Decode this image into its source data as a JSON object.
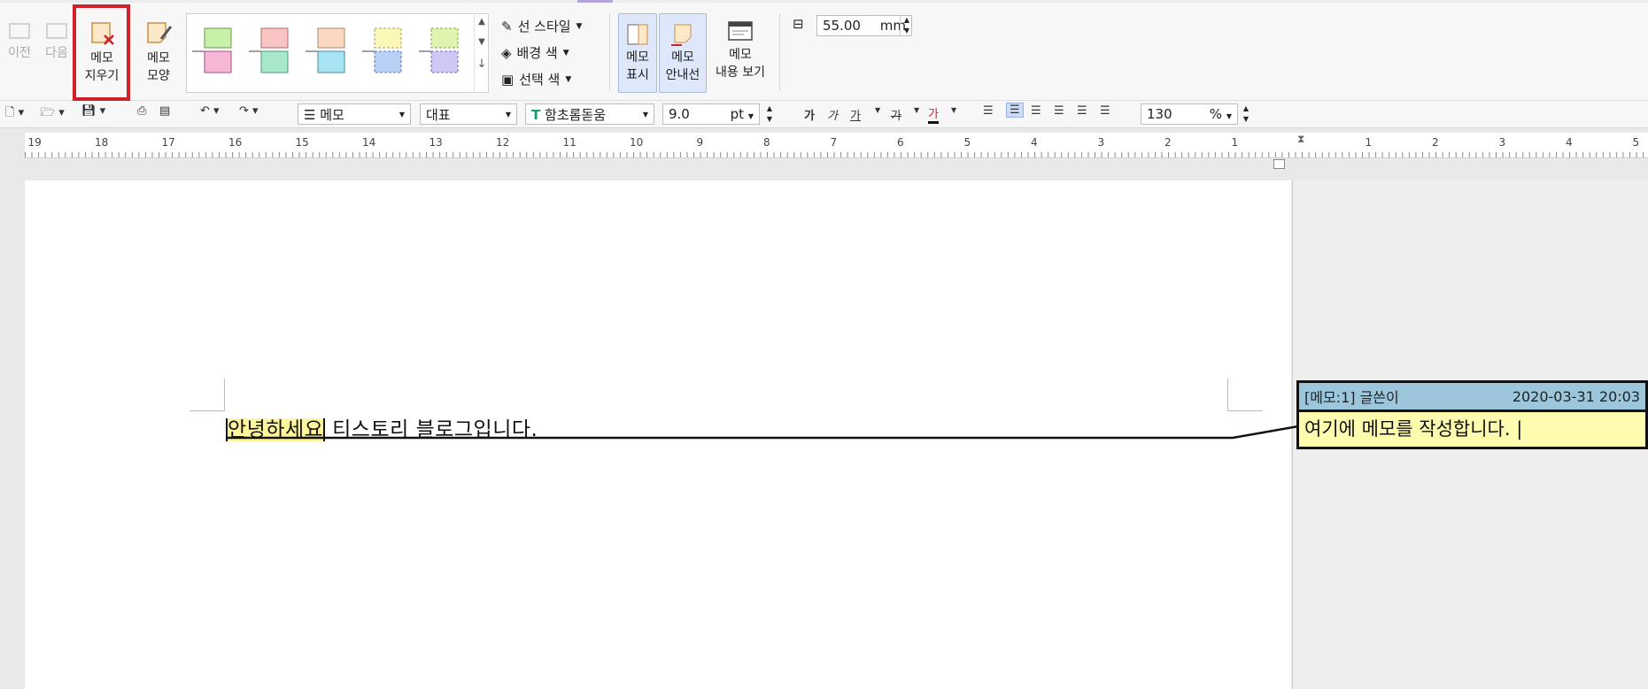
{
  "ribbon": {
    "prev_label": "이전",
    "next_label": "다음",
    "delete_memo_label": [
      "메모",
      "지우기"
    ],
    "memo_shape_label": [
      "메모",
      "모양"
    ],
    "line_style_label": "선 스타일",
    "bg_color_label": "배경 색",
    "select_color_label": "선택 색",
    "memo_show_label": [
      "메모",
      "표시"
    ],
    "memo_guide_label": [
      "메모",
      "안내선"
    ],
    "memo_view_label": [
      "메모",
      "내용 보기"
    ],
    "memo_width_value": "55.00",
    "memo_width_unit": "mm"
  },
  "toolbar": {
    "style_value": "메모",
    "lang_value": "대표",
    "font_value": "함초롬돋움",
    "size_value": "9.0",
    "size_unit": "pt",
    "zoom_value": "130",
    "zoom_unit": "%",
    "char_bold": "가",
    "char_italic": "가",
    "char_underline": "가",
    "char_strike": "가",
    "char_color": "가"
  },
  "ruler": {
    "left_labels": [
      "19",
      "18",
      "17",
      "16",
      "15",
      "14",
      "13",
      "12",
      "11",
      "10",
      "9",
      "8",
      "7",
      "6",
      "5",
      "4",
      "3",
      "2",
      "1"
    ],
    "right_labels": [
      "1",
      "2",
      "3",
      "4",
      "5"
    ]
  },
  "document": {
    "highlighted": "안녕하세요",
    "rest": " 티스토리 블로그입니다."
  },
  "memo": {
    "header": "[메모:1] 글쓴이",
    "date": "2020-03-31 20:03",
    "body": "여기에 메모를 작성합니다. |"
  },
  "colors": {
    "highlight_red": "#d0202a",
    "memo_header": "#9cc6dc",
    "memo_body": "#fffcb0",
    "toggle_active": "#dfe8fb"
  }
}
